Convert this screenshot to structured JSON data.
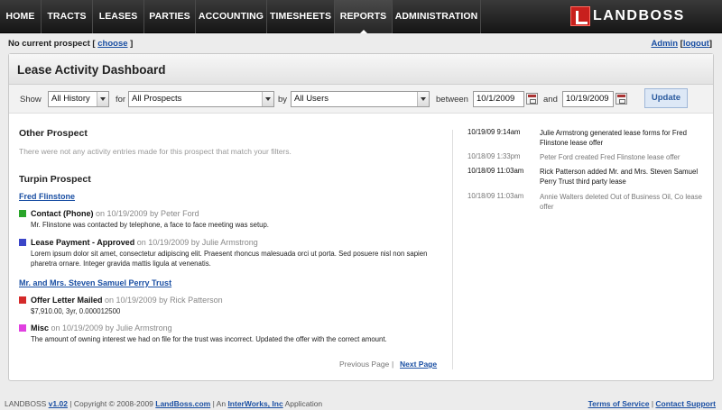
{
  "nav": [
    "HOME",
    "TRACTS",
    "LEASES",
    "PARTIES",
    "ACCOUNTING",
    "TIMESHEETS",
    "REPORTS",
    "ADMINISTRATION"
  ],
  "nav_active": "REPORTS",
  "logo": {
    "text": "LANDBOSS"
  },
  "prospect_bar": {
    "label": "No current prospect [",
    "choose": "choose",
    "close": "]"
  },
  "user_links": {
    "user": "Admin",
    "sep_open": " [",
    "logout": "logout",
    "sep_close": "]"
  },
  "page_title": "Lease Activity Dashboard",
  "filters": {
    "show_label": "Show",
    "show_value": "All History",
    "for_label": "for",
    "for_value": "All Prospects",
    "by_label": "by",
    "by_value": "All Users",
    "between_label": "between",
    "start_date": "10/1/2009",
    "and_label": "and",
    "end_date": "10/19/2009",
    "update_label": "Update"
  },
  "other_prospect": {
    "heading": "Other Prospect",
    "note": "There were not any activity entries made for this prospect that match your filters."
  },
  "turpin": {
    "heading": "Turpin Prospect",
    "party1": "Fred Flinstone",
    "party2": "Mr. and Mrs. Steven Samuel Perry Trust",
    "entries": [
      {
        "title": "Contact (Phone)",
        "meta": " on 10/19/2009 by Peter Ford",
        "body": "Mr. Flinstone was contacted by telephone, a face to face meeting was setup."
      },
      {
        "title": "Lease Payment - Approved",
        "meta": " on 10/19/2009 by Julie Armstrong",
        "body": "Lorem ipsum dolor sit amet, consectetur adipiscing elit. Praesent rhoncus malesuada orci ut porta. Sed posuere nisl non sapien pharetra ornare. Integer gravida mattis ligula at venenatis."
      },
      {
        "title": "Offer Letter Mailed",
        "meta": " on 10/19/2009 by Rick Patterson",
        "body": "$7,910.00, 3yr, 0.000012500"
      },
      {
        "title": "Misc",
        "meta": " on 10/19/2009 by Julie Armstrong",
        "body": "The amount of owning interest we had on file for the trust was incorrect.  Updated the offer with the correct amount."
      }
    ],
    "entry_colors": [
      "#2aa52a",
      "#3b45c8",
      "#d42a2a",
      "#e040e0"
    ]
  },
  "pager": {
    "prev": "Previous Page",
    "sep": "|",
    "next": "Next Page"
  },
  "recent_activity": [
    {
      "date": "10/19/09 9:14am",
      "text": "Julie Armstrong generated lease forms for Fred Flinstone lease offer"
    },
    {
      "date": "10/18/09 1:33pm",
      "text": "Peter Ford created Fred Flinstone lease offer"
    },
    {
      "date": "10/18/09 11:03am",
      "text": "Rick Patterson added Mr. and Mrs. Steven Samuel Perry Trust third party lease"
    },
    {
      "date": "10/18/09 11:03am",
      "text": "Annie Walters deleted Out of Business Oil, Co lease offer"
    }
  ],
  "footer": {
    "brand": "LANDBOSS",
    "version": "v1.02",
    "copyright": " | Copyright © 2008-2009 ",
    "site": "LandBoss.com",
    "an": " | An ",
    "company": "InterWorks, Inc",
    "app": " Application",
    "terms": "Terms of Service",
    "sep": " | ",
    "support": "Contact Support"
  }
}
